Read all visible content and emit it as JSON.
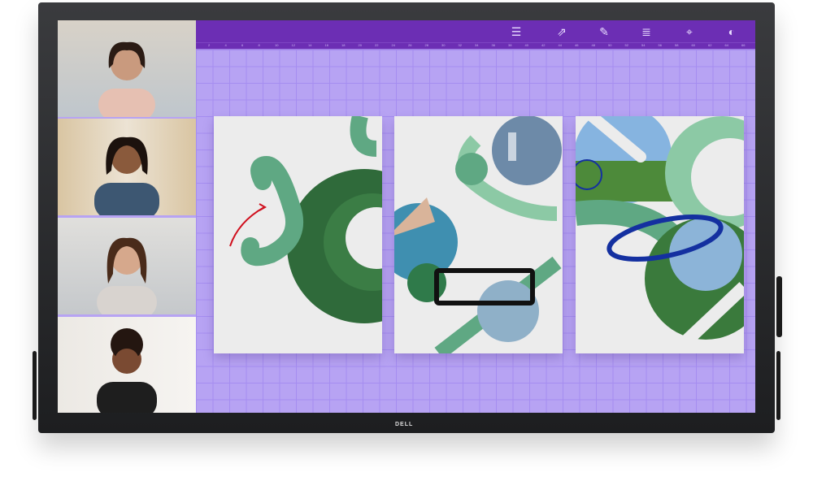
{
  "brand": "DELL",
  "toolbar": {
    "tools": [
      {
        "icon": "sliders-icon",
        "glyph": "☰"
      },
      {
        "icon": "share-screen-icon",
        "glyph": "⇗"
      },
      {
        "icon": "pencil-icon",
        "glyph": "✎"
      },
      {
        "icon": "layers-icon",
        "glyph": "≣"
      },
      {
        "icon": "focus-target-icon",
        "glyph": "⌖"
      },
      {
        "icon": "palette-icon",
        "glyph": "◐"
      }
    ]
  },
  "ruler": {
    "ticks": [
      "2",
      "4",
      "6",
      "8",
      "10",
      "12",
      "14",
      "16",
      "18",
      "20",
      "22",
      "24",
      "26",
      "28",
      "30",
      "32",
      "34",
      "36",
      "38",
      "40",
      "42",
      "44",
      "46",
      "48",
      "50",
      "52",
      "54",
      "56",
      "58",
      "60",
      "62",
      "64",
      "66"
    ]
  },
  "video_participants": 4,
  "colors": {
    "toolbar": "#6c2eb4",
    "canvas": "#b7a3f3",
    "accent_green": "#5fa883",
    "ink_red": "#d0101e",
    "ink_blue": "#1430a0"
  }
}
